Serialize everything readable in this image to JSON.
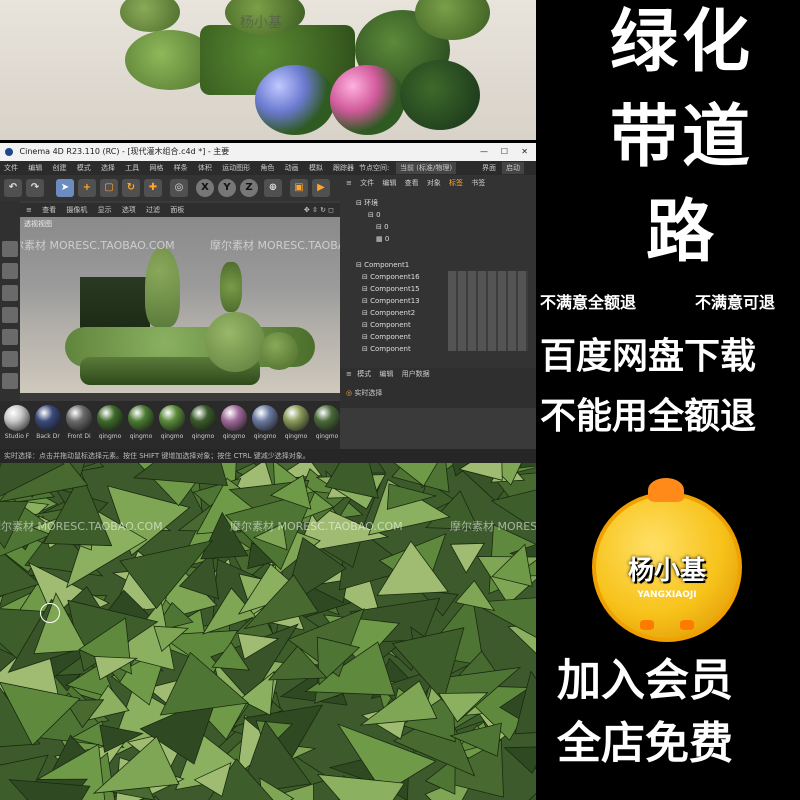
{
  "right_panel": {
    "title_line1": "绿化",
    "title_line2": "带道",
    "title_line3": "路",
    "refund_left": "不满意全额退",
    "refund_right": "不满意可退",
    "download": "百度网盘下载",
    "unusable_refund": "不能用全额退",
    "logo_text": "杨小基",
    "logo_subtext": "YANGXIAOJI",
    "member_line1": "加入会员",
    "member_line2": "全店免费"
  },
  "watermarks": {
    "brand": "摩尔素材",
    "url": "MORESC.TAOBAO.COM",
    "top_logo": "杨小基"
  },
  "c4d": {
    "title": "Cinema 4D R23.110 (RC) - [现代灌木组合.c4d *] - 主要",
    "menu": [
      "文件",
      "编辑",
      "创建",
      "模式",
      "选择",
      "工具",
      "网格",
      "样条",
      "体积",
      "运动图形",
      "角色",
      "动画",
      "模拟",
      "跟踪器"
    ],
    "node_space_label": "节点空间:",
    "node_space_value": "当前 (标准/物理)",
    "interface_label": "界面",
    "interface_value": "启动",
    "axis_buttons": [
      "X",
      "Y",
      "Z"
    ],
    "viewport_menu": [
      "查看",
      "摄像机",
      "显示",
      "选项",
      "过滤",
      "面板"
    ],
    "viewport_name": "透视视图",
    "object_menu": [
      "文件",
      "编辑",
      "查看",
      "对象",
      "标签",
      "书签"
    ],
    "objects": [
      "环境",
      "0",
      "0",
      "0",
      "Component1",
      "Component16",
      "Component15",
      "Component13",
      "Component2",
      "Component",
      "Component",
      "Component"
    ],
    "attr_menu": [
      "模式",
      "编辑",
      "用户数据"
    ],
    "attr_mode": "实时选择",
    "materials": [
      "Studio F",
      "Back Dr",
      "Front Di",
      "qingmo",
      "qingmo",
      "qingmo",
      "qingmo",
      "qingmo",
      "qingmo",
      "qingmo",
      "qingmo"
    ],
    "status": "实时选择：点击并拖动鼠标选择元素。按住 SHIFT 键增加选择对象；按住 CTRL 键减少选择对象。"
  },
  "colors": {
    "accent_orange": "#ffa62b",
    "logo_yellow": "#f7c21a",
    "leaf_green": "#5a7a3a"
  }
}
